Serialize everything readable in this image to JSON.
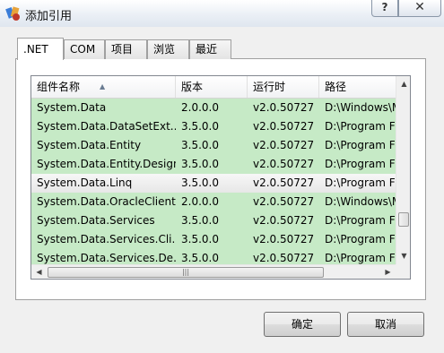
{
  "window": {
    "title": "添加引用",
    "help_label": "?",
    "close_label": "✕"
  },
  "tabs": [
    {
      "label": ".NET",
      "active": true
    },
    {
      "label": "COM",
      "active": false
    },
    {
      "label": "项目",
      "active": false
    },
    {
      "label": "浏览",
      "active": false
    },
    {
      "label": "最近",
      "active": false
    }
  ],
  "table": {
    "columns": [
      "组件名称",
      "版本",
      "运行时",
      "路径"
    ],
    "rows": [
      [
        "System.Data",
        "2.0.0.0",
        "v2.0.50727",
        "D:\\Windows\\M"
      ],
      [
        "System.Data.DataSetExt...",
        "3.5.0.0",
        "v2.0.50727",
        "D:\\Program F"
      ],
      [
        "System.Data.Entity",
        "3.5.0.0",
        "v2.0.50727",
        "D:\\Program F"
      ],
      [
        "System.Data.Entity.Design",
        "3.5.0.0",
        "v2.0.50727",
        "D:\\Program F"
      ],
      [
        "System.Data.Linq",
        "3.5.0.0",
        "v2.0.50727",
        "D:\\Program F"
      ],
      [
        "System.Data.OracleClient",
        "2.0.0.0",
        "v2.0.50727",
        "D:\\Windows\\M"
      ],
      [
        "System.Data.Services",
        "3.5.0.0",
        "v2.0.50727",
        "D:\\Program F"
      ],
      [
        "System.Data.Services.Cli...",
        "3.5.0.0",
        "v2.0.50727",
        "D:\\Program F"
      ],
      [
        "System.Data.Services.De...",
        "3.5.0.0",
        "v2.0.50727",
        "D:\\Program F"
      ]
    ],
    "selected_row": 4
  },
  "buttons": {
    "ok_label": "确定",
    "cancel_label": "取消"
  },
  "colors": {
    "row_highlight": "#c6eac6",
    "selected_row": "#ececec"
  }
}
